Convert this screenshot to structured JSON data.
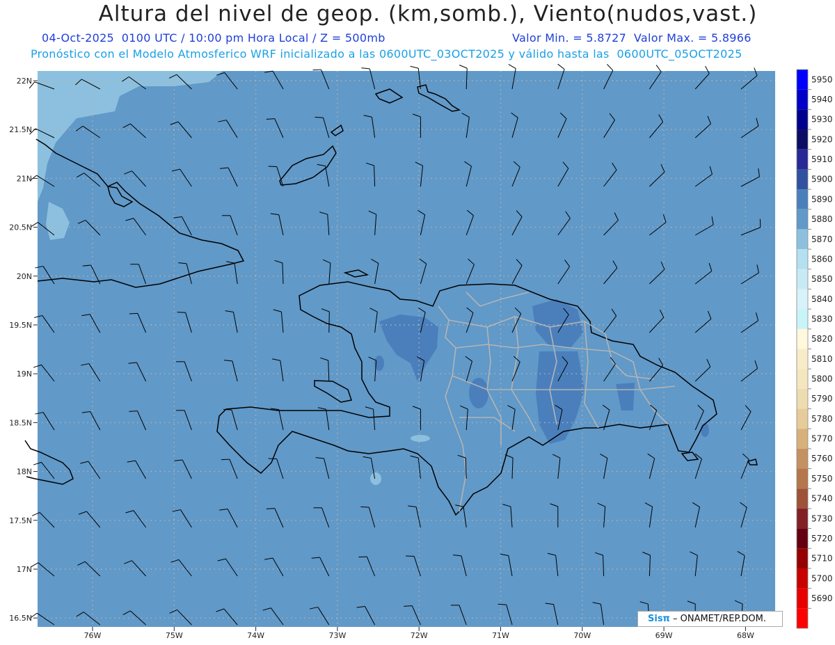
{
  "header": {
    "title": "Altura del nivel de geop. (km,somb.), Viento(nudos,vast.)",
    "line1_left": "04-Oct-2025  0100 UTC / 10:00 pm Hora Local / Z = 500mb",
    "line1_right": "Valor Min. = 5.8727  Valor Max. = 5.8966",
    "line2": "Pronóstico con el Modelo Atmosferico WRF inicializado a las 0600UTC_03OCT2025 y válido hasta las  0600UTC_05OCT2025"
  },
  "map": {
    "lat_labels": [
      "22N",
      "21.5N",
      "21N",
      "20.5N",
      "20N",
      "19.5N",
      "19N",
      "18.5N",
      "18N",
      "17.5N",
      "17N",
      "16.5N"
    ],
    "lon_labels": [
      "76W",
      "75W",
      "74W",
      "73W",
      "72W",
      "71W",
      "70W",
      "69W",
      "68W"
    ],
    "background_color": "#6199c8",
    "grid_style": "dotted"
  },
  "colorbar": {
    "levels": [
      "5950",
      "5940",
      "5930",
      "5920",
      "5910",
      "5900",
      "5890",
      "5880",
      "5870",
      "5860",
      "5850",
      "5840",
      "5830",
      "5820",
      "5810",
      "5800",
      "5790",
      "5780",
      "5770",
      "5760",
      "5750",
      "5740",
      "5730",
      "5720",
      "5710",
      "5700",
      "5690"
    ],
    "colors": [
      "#0000ff",
      "#0000c8",
      "#00008c",
      "#0c0c64",
      "#282896",
      "#3050a0",
      "#4a7fbc",
      "#6199c8",
      "#8cc0de",
      "#b4e0f0",
      "#c8eaf4",
      "#d8f2fa",
      "#c8f4f8",
      "#fff8dc",
      "#f8ecc8",
      "#f4e6be",
      "#ecdcb0",
      "#e6cc9a",
      "#d8b07a",
      "#c49160",
      "#b4764a",
      "#9e5238",
      "#822028",
      "#640010",
      "#960000",
      "#c80000",
      "#e80000",
      "#ff0000"
    ]
  },
  "credit": {
    "logo": "Sisπ",
    "text": "– ONAMET/REP.DOM."
  }
}
